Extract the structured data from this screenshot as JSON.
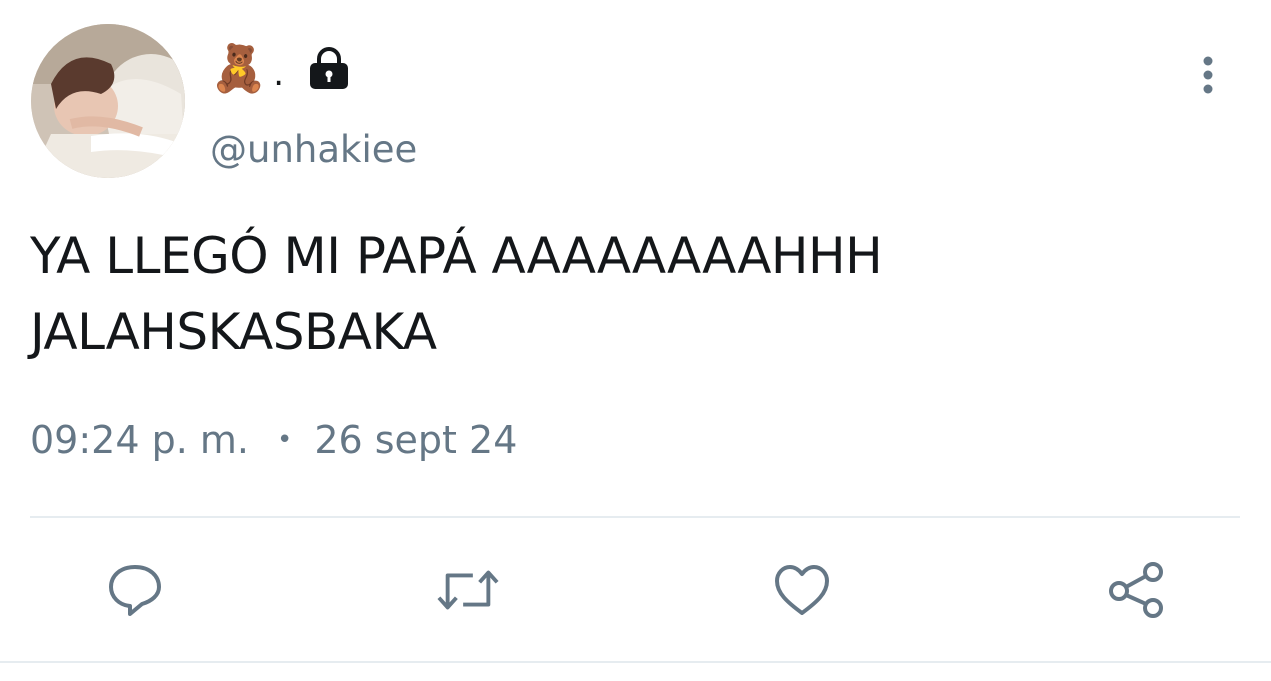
{
  "user": {
    "display_name_emoji": "🧸",
    "display_name_suffix": ".",
    "handle": "@unhakiee",
    "avatar_icon": "avatar-photo",
    "protected_icon": "lock-icon"
  },
  "tweet": {
    "text": "YA LLEGÓ MI PAPÁ AAAAAAAAHHH\nJALAHSKASBAKA",
    "time": "09:24 p. m.",
    "separator": "•",
    "date": "26 sept 24"
  },
  "actions": {
    "reply_icon": "reply-icon",
    "retweet_icon": "retweet-icon",
    "like_icon": "heart-icon",
    "share_icon": "share-icon"
  },
  "colors": {
    "text": "#14171a",
    "secondary": "#657786",
    "divider": "#e6ecf0"
  }
}
